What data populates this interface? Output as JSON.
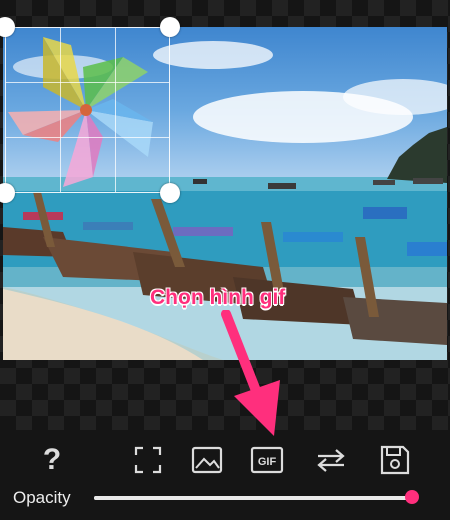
{
  "annotation": {
    "text": "Chọn hình gif"
  },
  "toolbar": {
    "help_label": "?",
    "items": [
      {
        "name": "help"
      },
      {
        "name": "crop-frame"
      },
      {
        "name": "image"
      },
      {
        "name": "gif",
        "label": "GIF"
      },
      {
        "name": "swap"
      },
      {
        "name": "save"
      }
    ]
  },
  "opacity": {
    "label": "Opacity",
    "value": 1.0
  },
  "colors": {
    "accent": "#ff2f7d",
    "background": "#151515",
    "icon": "#dcdcdc"
  }
}
